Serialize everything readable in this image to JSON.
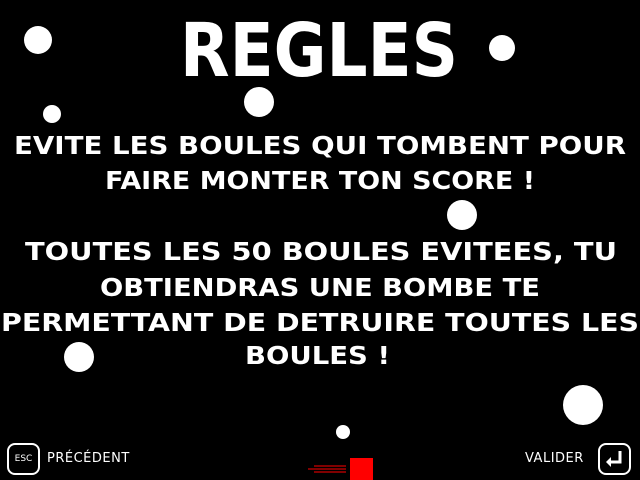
{
  "title": "REGLES",
  "rules_lines": [
    "EVITE LES BOULES QUI TOMBENT POUR",
    "FAIRE MONTER TON SCORE !",
    "TOUTES LES 50 BOULES EVITEES, TU",
    "OBTIENDRAS UNE BOMBE TE",
    "PERMETTANT DE DETRUIRE TOUTES LES",
    "BOULES !"
  ],
  "controls": {
    "back_key": "ESC",
    "back_label": "PRÉCÉDENT",
    "confirm_key_icon": "enter-icon",
    "confirm_label": "VALIDER"
  },
  "colors": {
    "background": "#000000",
    "text": "#ffffff",
    "player": "#ff0000"
  }
}
